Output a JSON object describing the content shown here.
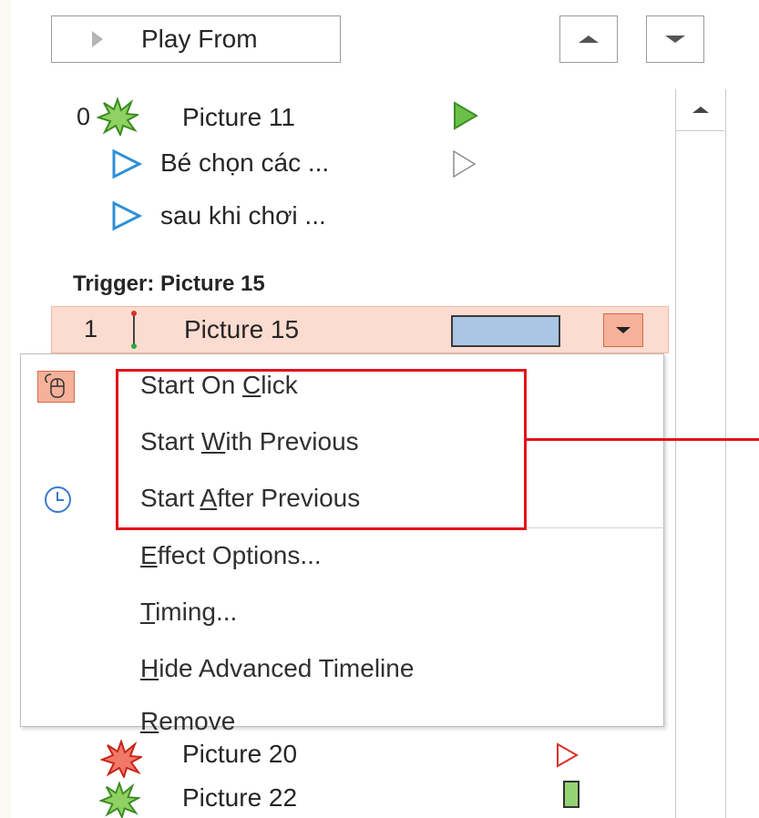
{
  "toolbar": {
    "play_from_label": "Play From",
    "move_up_icon": "triangle-up",
    "move_down_icon": "triangle-down"
  },
  "animations": [
    {
      "order": "0",
      "name": "Picture 11",
      "effect_icon": "starburst-green",
      "timing": "green-play"
    },
    {
      "order": "",
      "name": "Bé chọn các ...",
      "effect_icon": "outline-triangle-blue",
      "timing": "outline-play-gray"
    },
    {
      "order": "",
      "name": "sau khi chơi ...",
      "effect_icon": "outline-triangle-blue"
    }
  ],
  "trigger": {
    "label": "Trigger: Picture 15",
    "selected_item": {
      "order": "1",
      "name": "Picture 15",
      "effect_icon": "i-beam-red-green"
    }
  },
  "context_menu": {
    "items": [
      {
        "pre": "Start On ",
        "key": "C",
        "post": "lick",
        "icon": "mouse-icon"
      },
      {
        "pre": "Start ",
        "key": "W",
        "post": "ith Previous"
      },
      {
        "pre": "Start ",
        "key": "A",
        "post": "fter Previous",
        "icon": "clock-icon"
      },
      {
        "pre": "",
        "key": "E",
        "post": "ffect Options..."
      },
      {
        "pre": "",
        "key": "T",
        "post": "iming..."
      },
      {
        "pre": "",
        "key": "H",
        "post": "ide Advanced Timeline"
      },
      {
        "pre": "",
        "key": "R",
        "post": "emove"
      }
    ]
  },
  "below_menu": [
    {
      "name": "Picture 20",
      "effect_icon": "starburst-red"
    },
    {
      "name": "Picture 22",
      "effect_icon": "starburst-green"
    }
  ],
  "colors": {
    "selected_row_bg": "#fcdcd0",
    "highlight_border": "#e3121b",
    "timing_bar": "#a9c6e3",
    "play_green": "#6cc04a"
  }
}
